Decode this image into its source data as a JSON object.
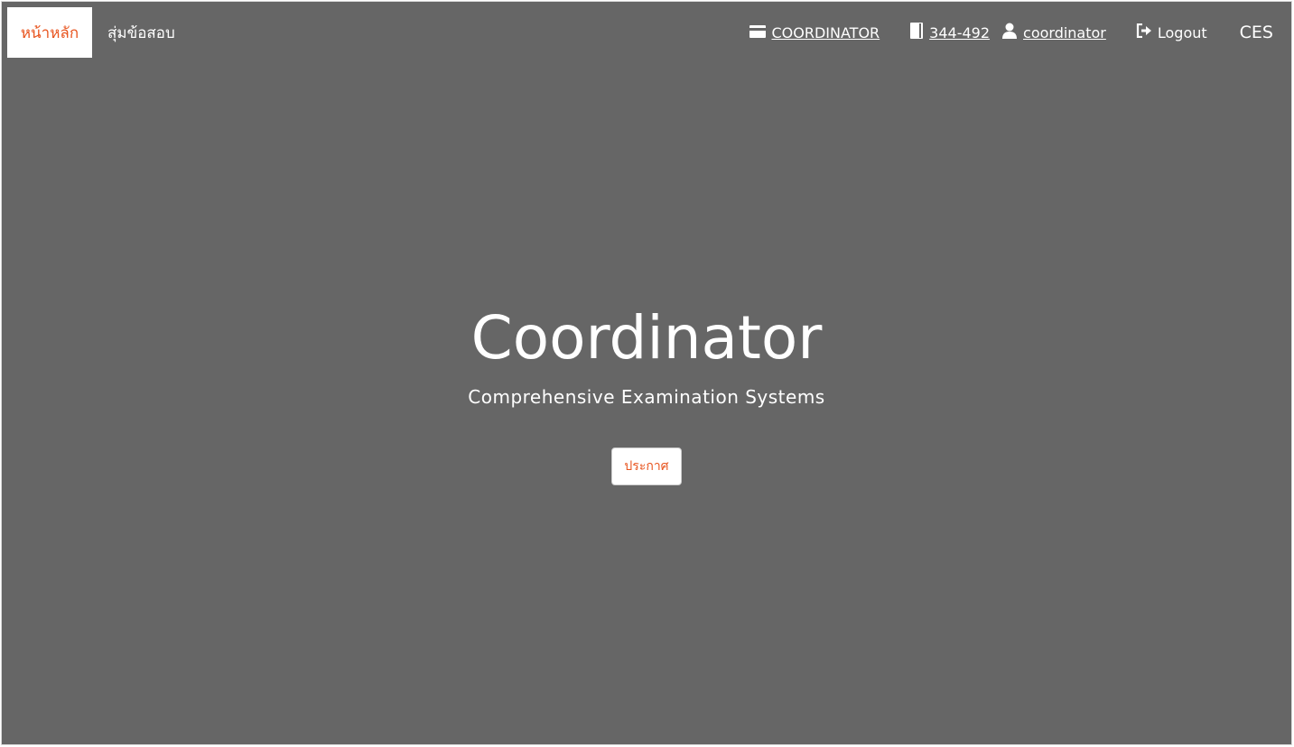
{
  "nav": {
    "home_label": "หน้าหลัก",
    "random_exam_label": "สุ่มข้อสอบ",
    "role_label": "COORDINATOR",
    "course_label": "344-492",
    "user_label": "coordinator",
    "logout_label": "Logout",
    "brand": "CES"
  },
  "hero": {
    "title": "Coordinator",
    "subtitle": "Comprehensive Examination Systems",
    "announce_button": "ประกาศ"
  },
  "colors": {
    "background": "#666666",
    "accent": "#e8541e",
    "text": "#ffffff"
  },
  "icons": {
    "role": "id-card-icon",
    "course": "book-icon",
    "user": "user-icon",
    "logout": "logout-icon"
  }
}
